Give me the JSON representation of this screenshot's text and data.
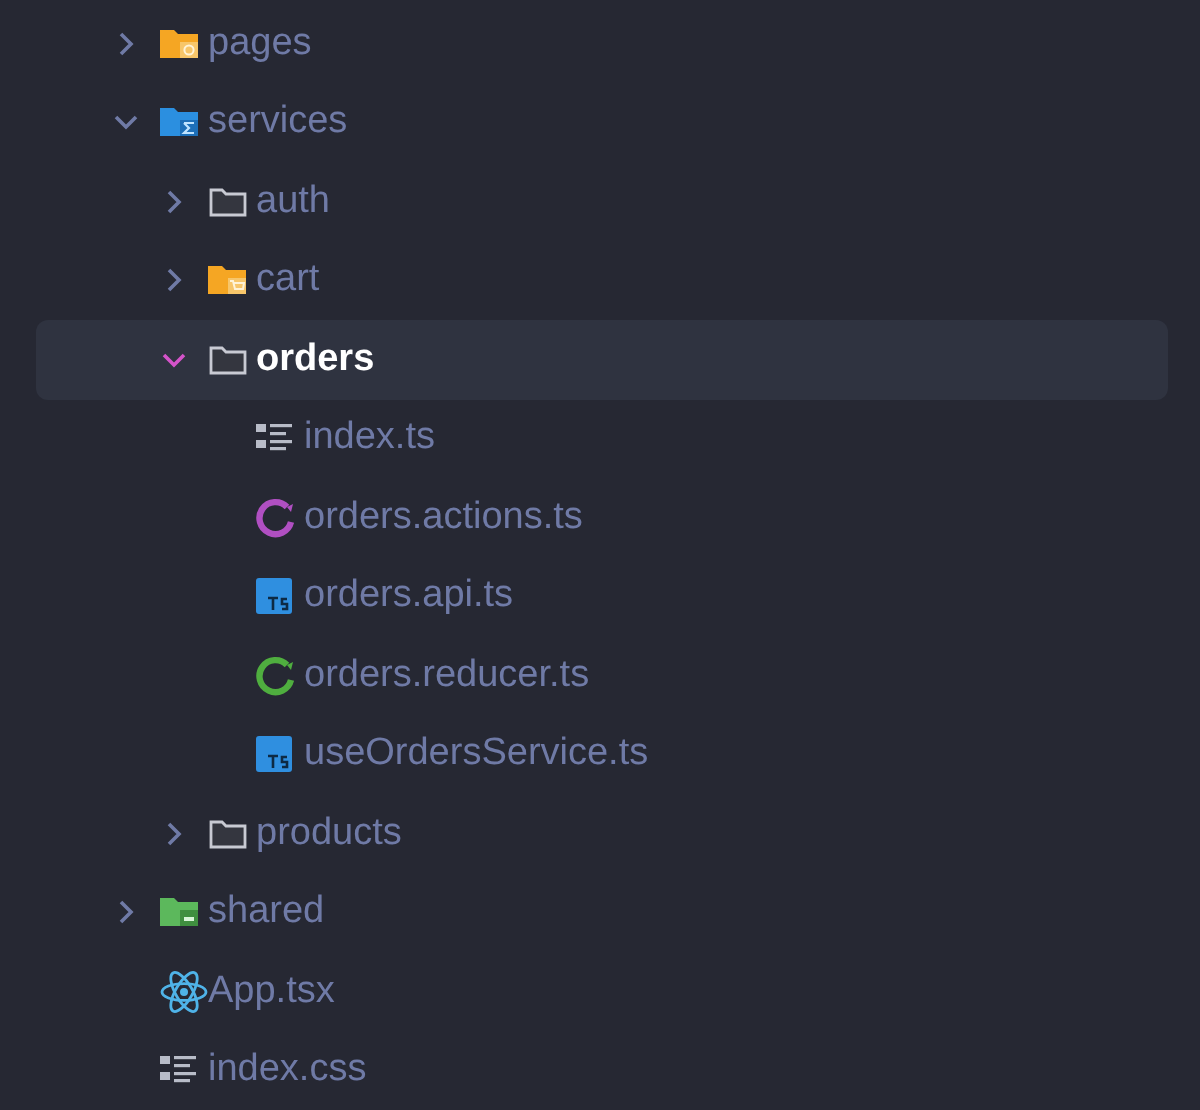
{
  "tree": [
    {
      "name": "pages",
      "kind": "pagesfolder",
      "expanded": false,
      "selected": false
    },
    {
      "name": "services",
      "kind": "servicesfolder",
      "expanded": true,
      "selected": false,
      "children": [
        {
          "name": "auth",
          "kind": "folder",
          "expanded": false,
          "selected": false
        },
        {
          "name": "cart",
          "kind": "cartfolder",
          "expanded": false,
          "selected": false
        },
        {
          "name": "orders",
          "kind": "folder",
          "expanded": true,
          "selected": true,
          "children": [
            {
              "name": "index.ts",
              "kind": "listfile",
              "selected": false
            },
            {
              "name": "orders.actions.ts",
              "kind": "actionsfile",
              "selected": false
            },
            {
              "name": "orders.api.ts",
              "kind": "tsfile",
              "selected": false
            },
            {
              "name": "orders.reducer.ts",
              "kind": "reducerfile",
              "selected": false
            },
            {
              "name": "useOrdersService.ts",
              "kind": "tsfile",
              "selected": false
            }
          ]
        },
        {
          "name": "products",
          "kind": "folder",
          "expanded": false,
          "selected": false
        }
      ]
    },
    {
      "name": "shared",
      "kind": "sharedfolder",
      "expanded": false,
      "selected": false
    },
    {
      "name": "App.tsx",
      "kind": "reactfile",
      "selected": false
    },
    {
      "name": "index.css",
      "kind": "listfile",
      "selected": false
    }
  ]
}
